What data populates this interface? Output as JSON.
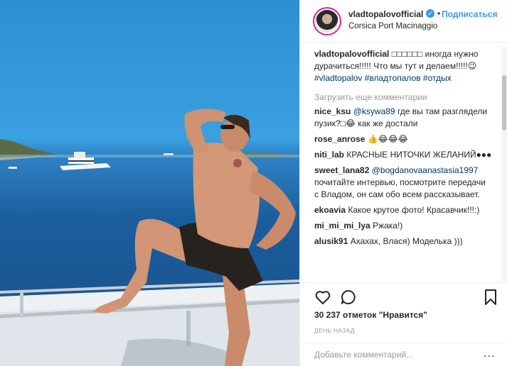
{
  "post": {
    "username": "vladtopalovofficial",
    "follow_label": "Подписаться",
    "dot": "•",
    "location": "Corsica Port Macinaggio"
  },
  "caption": {
    "username": "vladtopalovofficial",
    "text": "□□□□□□ иногда нужно дурачиться!!!!! Что мы тут и делаем!!!!!😉 ",
    "tags": [
      "#vladtopalov",
      "#владтопалов",
      "#отдых"
    ]
  },
  "load_more": "Загрузить еще комментарии",
  "comments": [
    {
      "user": "nice_ksu",
      "mention": "@ksywa89",
      "text": " где вы там разглядели пузик?□😂 как же достали"
    },
    {
      "user": "rose_anrose",
      "mention": "",
      "text": " 👍😂😂😂"
    },
    {
      "user": "niti_lab",
      "mention": "",
      "text": " КРАСНЫЕ НИТОЧКИ ЖЕЛАНИЙ●●●"
    },
    {
      "user": "sweet_lana82",
      "mention": "@bogdanovaanastasia1997",
      "text": " почитайте интервью, посмотрите передачи с Владом, он сам обо всем рассказывает."
    },
    {
      "user": "ekoavia",
      "mention": "",
      "text": " Какое крутое фото! Красавчик!!!:)"
    },
    {
      "user": "mi_mi_mi_lya",
      "mention": "",
      "text": " Ржака!)"
    },
    {
      "user": "alusik91",
      "mention": "",
      "text": " Ахахах, Влася) Моделька )))"
    }
  ],
  "likes": "30 237 отметок \"Нравится\"",
  "date": "ДЕНЬ НАЗАД",
  "add_comment_placeholder": "Добавьте комментарий...",
  "more_dots": "...",
  "icons": {
    "verified": "verified-badge-icon",
    "like": "heart-icon",
    "comment": "speech-bubble-icon",
    "save": "bookmark-icon"
  },
  "colors": {
    "link": "#3897f0",
    "hashtag": "#003569",
    "muted": "#999999"
  }
}
